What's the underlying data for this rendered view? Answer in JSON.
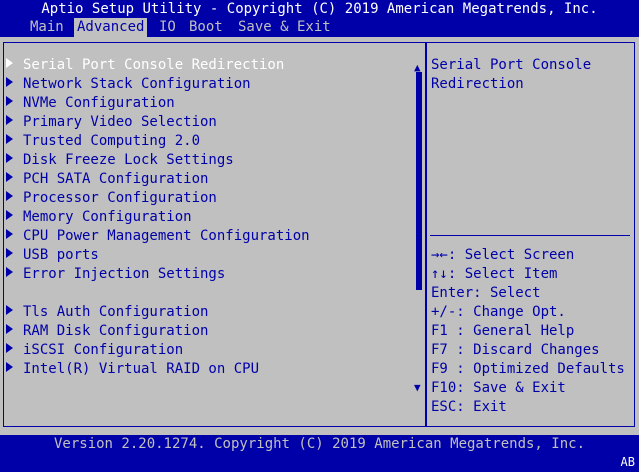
{
  "title": "Aptio Setup Utility - Copyright (C) 2019 American Megatrends, Inc.",
  "tabs": [
    "Main",
    "Advanced",
    "IO",
    "Boot",
    "Save & Exit"
  ],
  "active_tab": "Advanced",
  "menu": {
    "items": [
      "Serial Port Console Redirection",
      "Network Stack Configuration",
      "NVMe Configuration",
      "Primary Video Selection",
      "Trusted Computing 2.0",
      "Disk Freeze Lock Settings",
      "PCH SATA Configuration",
      "Processor Configuration",
      "Memory Configuration",
      "CPU Power Management Configuration",
      "USB ports",
      "Error Injection Settings",
      "Tls Auth Configuration",
      "RAM Disk Configuration",
      "iSCSI Configuration",
      "Intel(R) Virtual RAID on CPU"
    ],
    "selected": "Serial Port Console Redirection"
  },
  "help": {
    "line1": "Serial Port Console",
    "line2": "Redirection"
  },
  "keys": [
    "→←: Select Screen",
    "↑↓: Select Item",
    "Enter: Select",
    "+/-: Change Opt.",
    "F1 : General Help",
    "F7 : Discard Changes",
    "F9 : Optimized Defaults",
    "F10: Save & Exit",
    "ESC: Exit"
  ],
  "footer": "Version 2.20.1274. Copyright (C) 2019 American Megatrends, Inc.",
  "corner": "AB",
  "colors": {
    "background": "#0000a8",
    "panel": "#c0c0c0",
    "highlight": "#ffffff"
  }
}
